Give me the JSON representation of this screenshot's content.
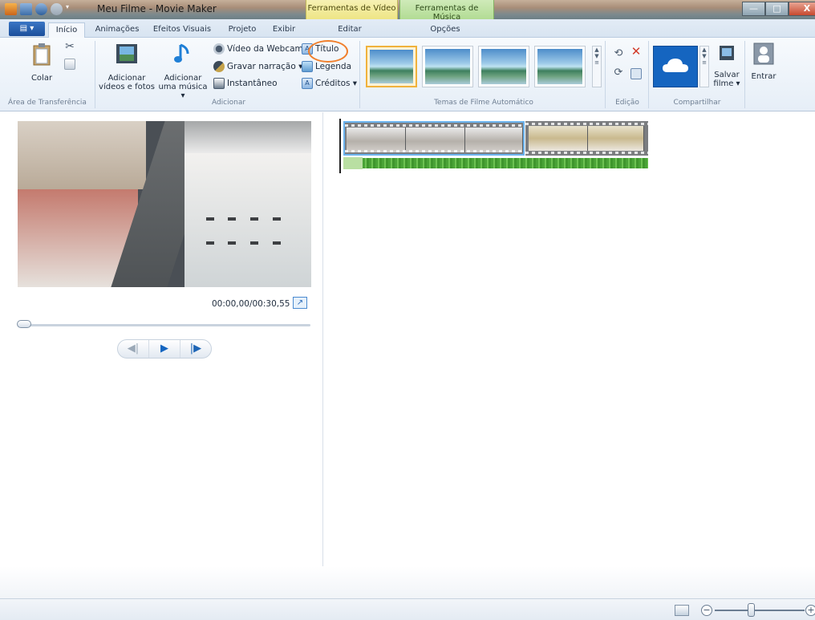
{
  "window": {
    "title": "Meu Filme - Movie Maker",
    "context_tabs": {
      "video_tools": "Ferramentas de Vídeo",
      "music_tools": "Ferramentas de Música"
    },
    "controls": {
      "minimize": "—",
      "maximize": "□",
      "close": "X"
    }
  },
  "ribbon_tabs": {
    "file_menu": "▤ ▾",
    "items": [
      "Início",
      "Animações",
      "Efeitos Visuais",
      "Projeto",
      "Exibir",
      "Editar",
      "Opções"
    ],
    "active": "Início"
  },
  "ribbon": {
    "clipboard": {
      "paste": "Colar",
      "group_label": "Área de Transferência"
    },
    "add": {
      "add_videos": "Adicionar vídeos e fotos",
      "add_videos_line1": "Adicionar",
      "add_videos_line2": "vídeos e fotos",
      "add_music_line1": "Adicionar",
      "add_music_line2": "uma música ▾",
      "webcam": "Vídeo da Webcam",
      "narration": "Gravar narração ▾",
      "snapshot": "Instantâneo",
      "title": "Título",
      "caption": "Legenda",
      "credits": "Créditos ▾",
      "group_label": "Adicionar"
    },
    "themes": {
      "group_label": "Temas de Filme Automático"
    },
    "editing": {
      "group_label": "Edição"
    },
    "share": {
      "save_line1": "Salvar",
      "save_line2": "filme ▾",
      "sign_in": "Entrar",
      "group_label": "Compartilhar"
    }
  },
  "preview": {
    "timecode": "00:00,00/00:30,55",
    "seek_position": 0.0
  },
  "colors": {
    "accent": "#1f66b6",
    "selected_theme": "#f0b23c",
    "annotation": "#f07f2c",
    "audio_wave": "#4aa337"
  }
}
